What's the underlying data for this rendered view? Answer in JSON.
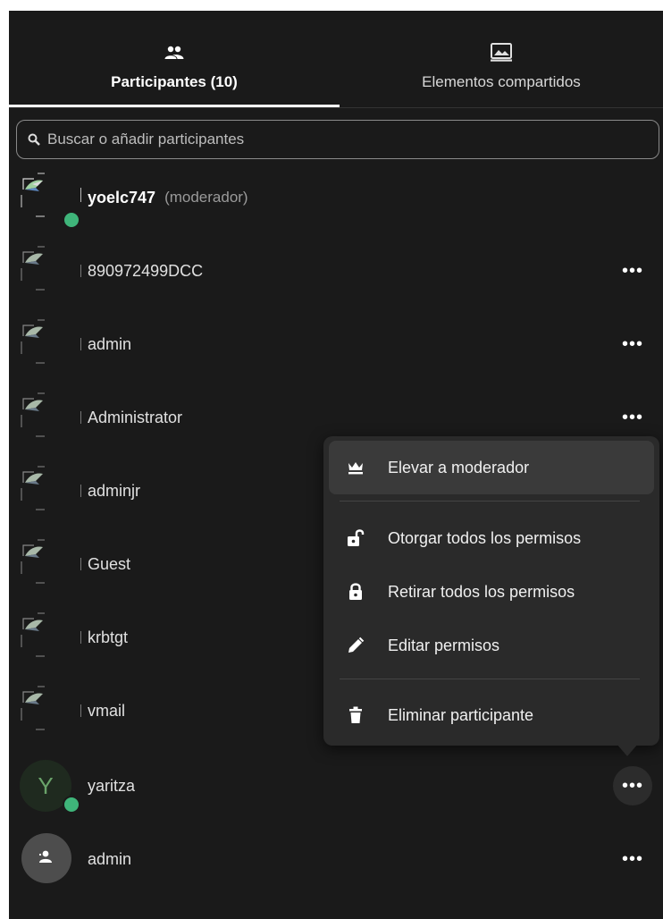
{
  "tabs": [
    {
      "label": "Participantes (10)",
      "icon": "people-icon",
      "active": true
    },
    {
      "label": "Elementos compartidos",
      "icon": "shared-items-icon",
      "active": false
    }
  ],
  "search": {
    "placeholder": "Buscar o añadir participantes"
  },
  "participants": [
    {
      "name": "yoelc747",
      "role": "(moderador)",
      "avatar": "broken-image-icon",
      "online": true,
      "has_menu": false
    },
    {
      "name": "890972499DCC",
      "avatar": "broken-image-icon",
      "online": false,
      "has_menu": true
    },
    {
      "name": "admin",
      "avatar": "broken-image-icon",
      "online": false,
      "has_menu": true
    },
    {
      "name": "Administrator",
      "avatar": "broken-image-icon",
      "online": false,
      "has_menu": true
    },
    {
      "name": "adminjr",
      "avatar": "broken-image-icon",
      "online": false,
      "has_menu": false
    },
    {
      "name": "Guest",
      "avatar": "broken-image-icon",
      "online": false,
      "has_menu": false
    },
    {
      "name": "krbtgt",
      "avatar": "broken-image-icon",
      "online": false,
      "has_menu": false
    },
    {
      "name": "vmail",
      "avatar": "broken-image-icon",
      "online": false,
      "has_menu": false
    },
    {
      "name": "yaritza",
      "avatar_letter": "Y",
      "online": true,
      "has_menu": true,
      "menu_open": true
    },
    {
      "name": "admin",
      "avatar": "group-icon",
      "online": false,
      "has_menu": true
    }
  ],
  "more_label": "•••",
  "menu": {
    "items": [
      {
        "label": "Elevar a moderador",
        "icon": "crown-icon"
      },
      {
        "label": "Otorgar todos los permisos",
        "icon": "unlock-icon"
      },
      {
        "label": "Retirar todos los permisos",
        "icon": "lock-icon"
      },
      {
        "label": "Editar permisos",
        "icon": "pencil-icon"
      },
      {
        "label": "Eliminar participante",
        "icon": "trash-icon"
      }
    ]
  },
  "colors": {
    "background": "#1a1a1a",
    "menu": "#2a2a2a",
    "online": "#3fb57a"
  }
}
